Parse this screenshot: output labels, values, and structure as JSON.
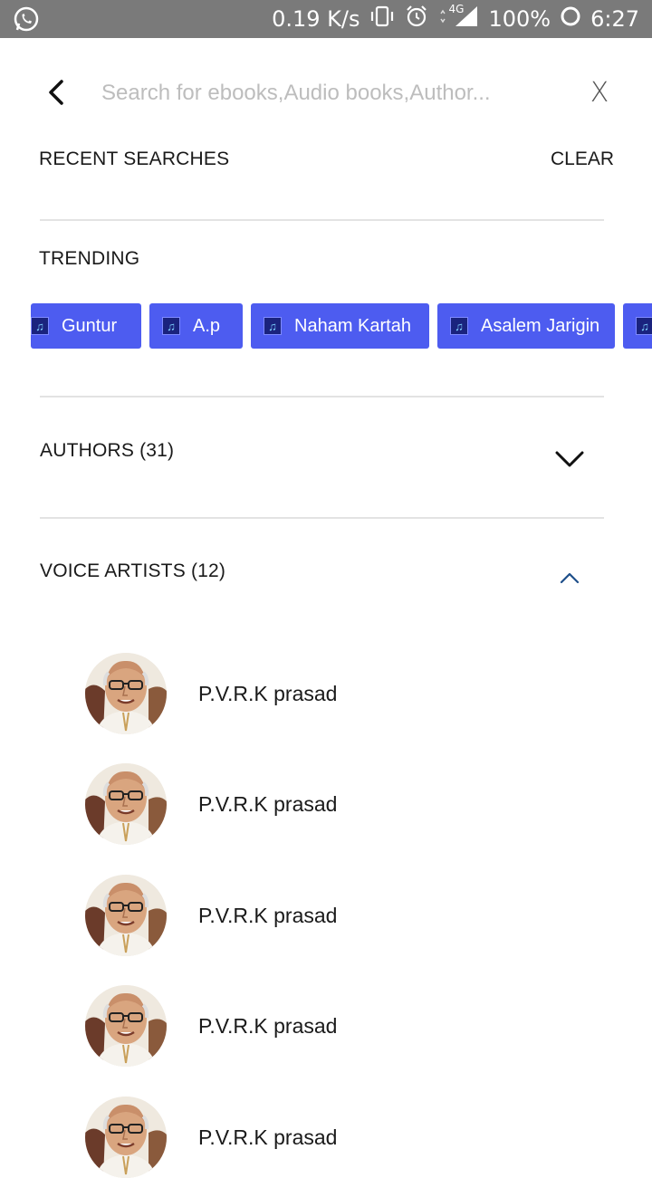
{
  "status_bar": {
    "net_speed": "0.19 K/s",
    "network": "4G",
    "battery": "100%",
    "time": "6:27"
  },
  "search": {
    "placeholder": "Search for ebooks,Audio books,Author...",
    "close_label": "X"
  },
  "recent": {
    "title": "RECENT SEARCHES",
    "clear_label": "CLEAR"
  },
  "trending": {
    "title": "TRENDING",
    "chips": [
      "Guntur",
      "A.p",
      "Naham Kartah",
      "Asalem Jarigin"
    ]
  },
  "authors": {
    "title": "AUTHORS (31)"
  },
  "voice_artists": {
    "title": "VOICE ARTISTS (12)",
    "items": [
      {
        "name": "P.V.R.K prasad"
      },
      {
        "name": "P.V.R.K prasad"
      },
      {
        "name": "P.V.R.K prasad"
      },
      {
        "name": "P.V.R.K prasad"
      },
      {
        "name": "P.V.R.K prasad"
      }
    ]
  },
  "colors": {
    "chip": "#4d5cf0",
    "statusbar": "#7a7a7a",
    "accent": "#1e4f8a"
  }
}
